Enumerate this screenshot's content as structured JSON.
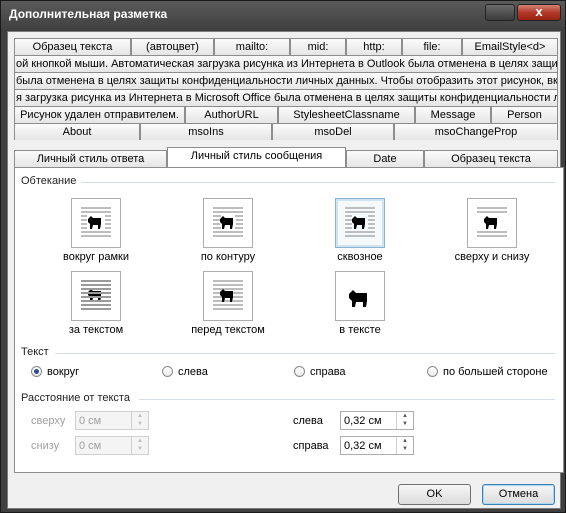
{
  "window": {
    "title": "Дополнительная разметка",
    "close_glyph": "x"
  },
  "tab_rows": [
    {
      "tabs": [
        "Образец текста",
        "(автоцвет)",
        "mailto:",
        "mid:",
        "http:",
        "file:",
        "EmailStyle<d>"
      ]
    },
    {
      "tabs": [
        "ой кнопкой мыши. Автоматическая загрузка рисунка из Интернета в Outlook была отменена в целях защит"
      ]
    },
    {
      "tabs": [
        "была отменена в целях защиты конфиденциальности личных данных. Чтобы отобразить этот рисунок, вк"
      ]
    },
    {
      "tabs": [
        "я загрузка рисунка из Интернета в Microsoft Office была отменена в целях защиты конфиденциальности ли"
      ]
    },
    {
      "tabs": [
        "Рисунок удален отправителем.",
        "AuthorURL",
        "StylesheetClassname",
        "Message",
        "Person"
      ]
    },
    {
      "tabs": [
        "About",
        "msoIns",
        "msoDel",
        "msoChangeProp"
      ]
    },
    {
      "tabs": [
        "Личный стиль ответа",
        "Личный стиль сообщения",
        "Date",
        "Образец текста"
      ],
      "active": 1
    }
  ],
  "wrap_section": {
    "title": "Обтекание",
    "options": [
      {
        "label": "вокруг рамки",
        "icon": "wrap-square-icon",
        "selected": false
      },
      {
        "label": "по контуру",
        "icon": "wrap-tight-icon",
        "selected": false
      },
      {
        "label": "сквозное",
        "icon": "wrap-through-icon",
        "selected": true
      },
      {
        "label": "сверху и снизу",
        "icon": "wrap-top-bottom-icon",
        "selected": false
      },
      {
        "label": "за текстом",
        "icon": "wrap-behind-text-icon",
        "selected": false
      },
      {
        "label": "перед текстом",
        "icon": "wrap-in-front-icon",
        "selected": false
      },
      {
        "label": "в тексте",
        "icon": "wrap-inline-icon",
        "selected": false
      }
    ]
  },
  "text_section": {
    "title": "Текст",
    "options": [
      {
        "label": "вокруг",
        "checked": true
      },
      {
        "label": "слева",
        "checked": false
      },
      {
        "label": "справа",
        "checked": false
      },
      {
        "label": "по большей стороне",
        "checked": false
      }
    ]
  },
  "distance_section": {
    "title": "Расстояние от текста",
    "top": {
      "label": "сверху",
      "value": "0 см",
      "disabled": true
    },
    "bottom": {
      "label": "снизу",
      "value": "0 см",
      "disabled": true
    },
    "left": {
      "label": "слева",
      "value": "0,32 см",
      "disabled": false
    },
    "right": {
      "label": "справа",
      "value": "0,32 см",
      "disabled": false
    }
  },
  "buttons": {
    "ok": "OK",
    "cancel": "Отмена"
  },
  "colors": {
    "selected_border": "#8bb2cf",
    "group_line": "#d5dfe5",
    "disabled_text": "#a0a0a0"
  }
}
